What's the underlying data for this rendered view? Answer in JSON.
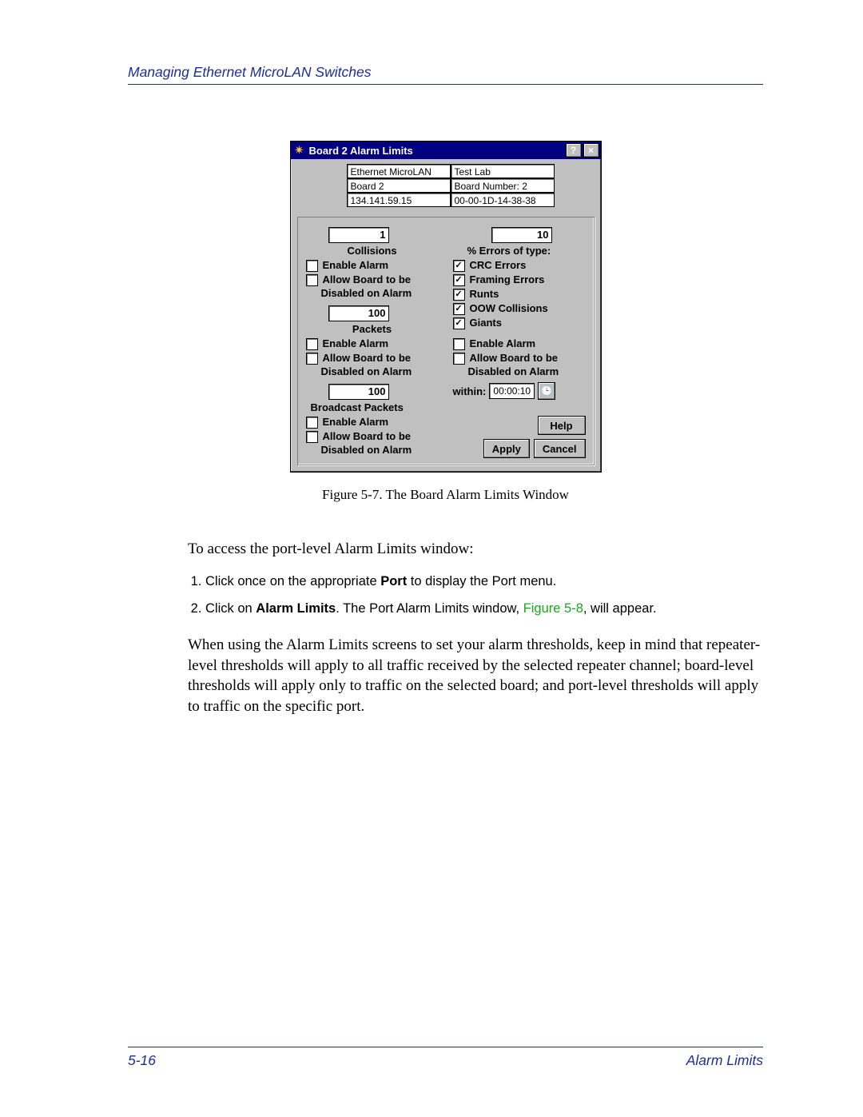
{
  "header": {
    "running_title": "Managing Ethernet MicroLAN Switches"
  },
  "dialog": {
    "title": "Board 2 Alarm Limits",
    "info": {
      "device": "Ethernet MicroLAN",
      "location": "Test Lab",
      "board": "Board 2",
      "board_number_label": "Board Number:  2",
      "ip": "134.141.59.15",
      "mac": "00-00-1D-14-38-38"
    },
    "left": {
      "collisions": {
        "value": "1",
        "label": "Collisions",
        "enable": "Enable Alarm",
        "allow1": "Allow Board to be",
        "allow2": "Disabled on Alarm"
      },
      "packets": {
        "value": "100",
        "label": "Packets",
        "enable": "Enable Alarm",
        "allow1": "Allow Board to be",
        "allow2": "Disabled on Alarm"
      },
      "broadcast": {
        "value": "100",
        "label": "Broadcast Packets",
        "enable": "Enable Alarm",
        "allow1": "Allow Board to be",
        "allow2": "Disabled on Alarm"
      }
    },
    "right": {
      "percent": {
        "value": "10",
        "label": "% Errors of type:"
      },
      "err": {
        "crc": "CRC Errors",
        "framing": "Framing Errors",
        "runts": "Runts",
        "oow": "OOW Collisions",
        "giants": "Giants"
      },
      "enable": "Enable Alarm",
      "allow1": "Allow Board to be",
      "allow2": "Disabled on Alarm",
      "within_label": "within:",
      "within_value": "00:00:10"
    },
    "buttons": {
      "help": "Help",
      "apply": "Apply",
      "cancel": "Cancel"
    }
  },
  "caption": "Figure 5-7. The Board Alarm Limits Window",
  "body": {
    "intro": "To access the port-level Alarm Limits window:",
    "step1_a": "Click once on the appropriate ",
    "step1_b": "Port",
    "step1_c": " to display the Port menu.",
    "step2_a": "Click on ",
    "step2_b": "Alarm Limits",
    "step2_c": ". The Port Alarm Limits window, ",
    "step2_link": "Figure 5-8",
    "step2_d": ", will appear.",
    "para": "When using the Alarm Limits screens to set your alarm thresholds, keep in mind that repeater-level thresholds will apply to all traffic received by the selected repeater channel; board-level thresholds will apply only to traffic on the selected board; and port-level thresholds will apply to traffic on the specific port."
  },
  "footer": {
    "page": "5-16",
    "section": "Alarm Limits"
  }
}
